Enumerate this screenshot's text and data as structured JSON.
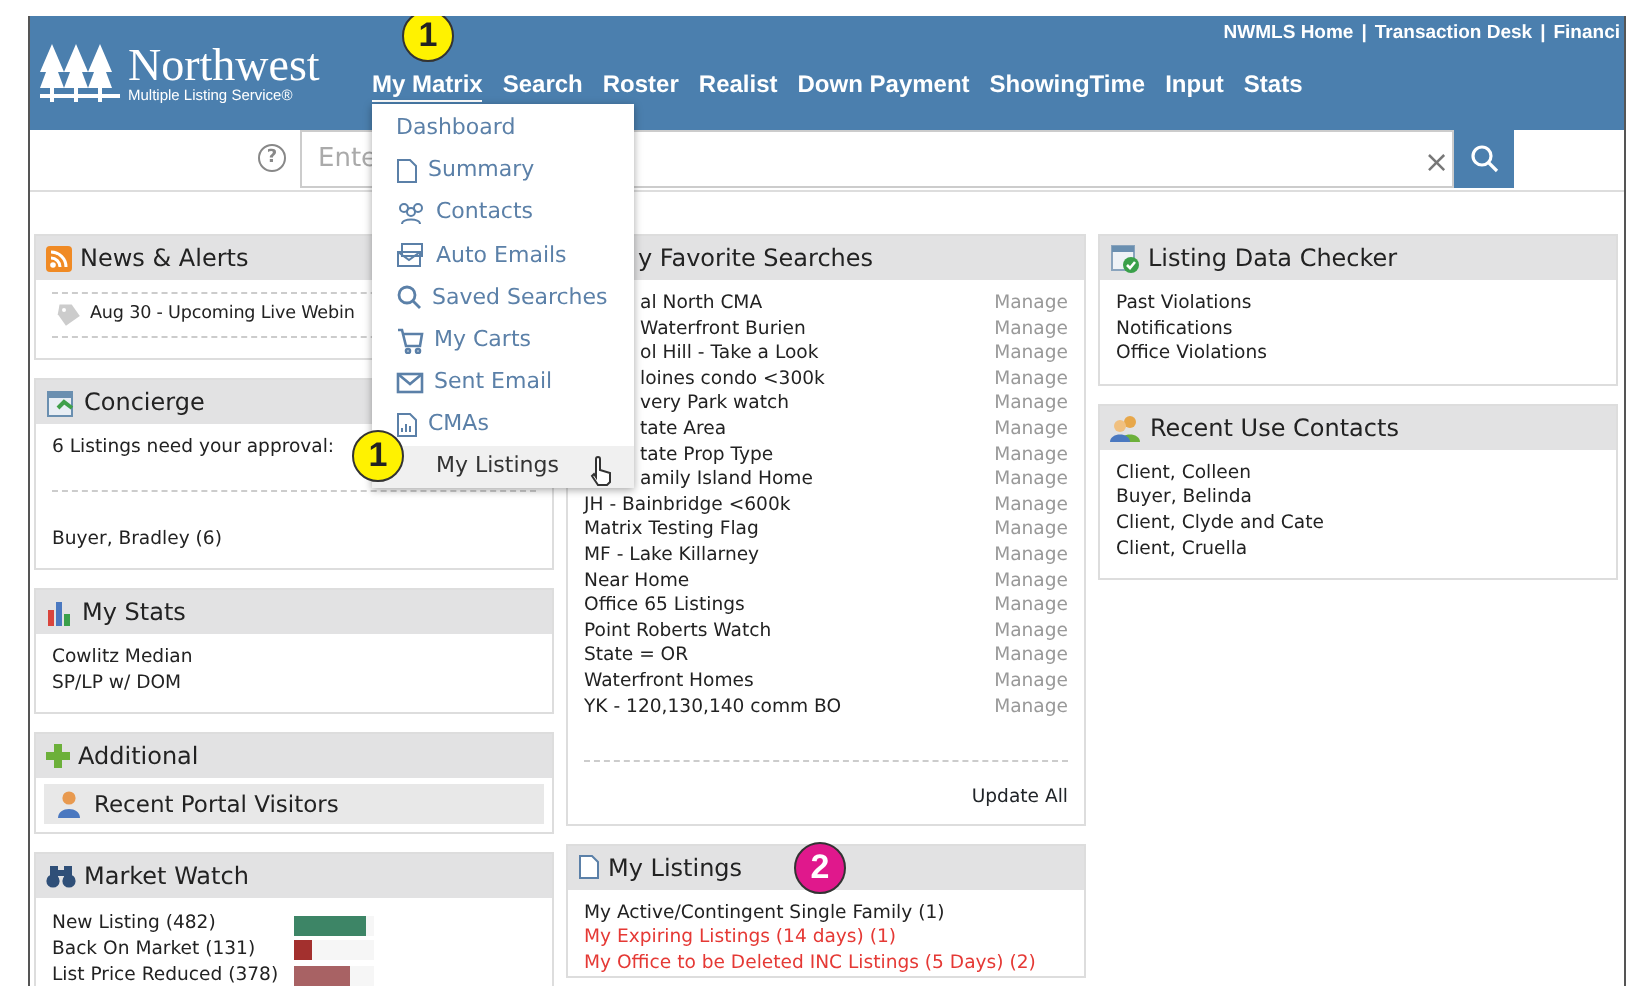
{
  "header": {
    "logo_title": "Northwest",
    "logo_subtitle": "Multiple Listing Service®",
    "top_links": [
      "NWMLS Home",
      "Transaction Desk",
      "Financi"
    ],
    "top_separator": "|",
    "nav": [
      {
        "label": "My Matrix",
        "selected": true,
        "callout": {
          "text": "1",
          "color": "#fff200"
        }
      },
      {
        "label": "Search",
        "selected": false
      },
      {
        "label": "Roster",
        "selected": false
      },
      {
        "label": "Realist",
        "selected": false
      },
      {
        "label": "Down Payment",
        "selected": false
      },
      {
        "label": "ShowingTime",
        "selected": false
      },
      {
        "label": "Input",
        "selected": false
      },
      {
        "label": "Stats",
        "selected": false
      }
    ]
  },
  "search": {
    "help": "?",
    "placeholder": "Ente",
    "clear": "×"
  },
  "nav_menu": {
    "items": [
      {
        "label": "Dashboard",
        "hovered": false
      },
      {
        "label": "Summary",
        "hovered": false
      },
      {
        "label": "Contacts",
        "hovered": false
      },
      {
        "label": "Auto Emails",
        "hovered": false
      },
      {
        "label": "Saved Searches",
        "hovered": false
      },
      {
        "label": "My Carts",
        "hovered": false
      },
      {
        "label": "Sent Email",
        "hovered": false
      },
      {
        "label": "CMAs",
        "hovered": false
      },
      {
        "label": "My Listings",
        "hovered": true,
        "callout": {
          "text": "1",
          "color": "#fff200"
        }
      }
    ]
  },
  "columns": [
    [
      {
        "title": "News & Alerts",
        "kind": "news",
        "items": [
          "Aug 30 - Upcoming Live Webin"
        ]
      },
      {
        "title": "Concierge",
        "kind": "approval",
        "prompt": "6 Listings need your approval:",
        "items": [
          "Buyer, Bradley (6)"
        ]
      },
      {
        "title": "My Stats",
        "kind": "links",
        "items": [
          {
            "text": "Cowlitz Median",
            "alert": false
          },
          {
            "text": "SP/LP w/ DOM",
            "alert": false
          }
        ]
      },
      {
        "title": "Additional",
        "kind": "sublinks",
        "items": [
          "Recent Portal Visitors"
        ]
      },
      {
        "title": "Market Watch",
        "kind": "bars",
        "items": [
          {
            "label": "New Listing (482)",
            "level": 0.9,
            "color": "#3d8566"
          },
          {
            "label": "Back On Market (131)",
            "level": 0.22,
            "color": "#a3302e"
          },
          {
            "label": "List Price Reduced (378)",
            "level": 0.7,
            "color": "#a86264"
          }
        ]
      }
    ],
    [
      {
        "title": "y Favorite Searches",
        "title_clipped": true,
        "kind": "manage",
        "footer": "Update All",
        "rows": [
          {
            "name": "al North CMA",
            "action": "Manage",
            "clipped": true
          },
          {
            "name": "Waterfront Burien",
            "action": "Manage",
            "clipped": true
          },
          {
            "name": "ol Hill - Take a Look",
            "action": "Manage",
            "clipped": true
          },
          {
            "name": "loines condo <300k",
            "action": "Manage",
            "clipped": true
          },
          {
            "name": "very Park watch",
            "action": "Manage",
            "clipped": true
          },
          {
            "name": "tate Area",
            "action": "Manage",
            "clipped": true
          },
          {
            "name": "tate Prop Type",
            "action": "Manage",
            "clipped": true
          },
          {
            "name": "amily Island Home",
            "action": "Manage",
            "clipped": true
          },
          {
            "name": "JH - Bainbridge <600k",
            "action": "Manage",
            "clipped": false
          },
          {
            "name": "Matrix Testing Flag",
            "action": "Manage",
            "clipped": false
          },
          {
            "name": "MF - Lake Killarney",
            "action": "Manage",
            "clipped": false
          },
          {
            "name": "Near Home",
            "action": "Manage",
            "clipped": false
          },
          {
            "name": "Office 65 Listings",
            "action": "Manage",
            "clipped": false
          },
          {
            "name": "Point Roberts Watch",
            "action": "Manage",
            "clipped": false
          },
          {
            "name": "State = OR",
            "action": "Manage",
            "clipped": false
          },
          {
            "name": "Waterfront Homes",
            "action": "Manage",
            "clipped": false
          },
          {
            "name": "YK - 120,130,140 comm BO",
            "action": "Manage",
            "clipped": false
          }
        ]
      },
      {
        "title": "My Listings",
        "kind": "links",
        "callout": {
          "text": "2",
          "color": "#e0188c"
        },
        "items": [
          {
            "text": "My Active/Contingent Single Family (1)",
            "alert": false
          },
          {
            "text": "My Expiring Listings (14 days) (1)",
            "alert": true
          },
          {
            "text": "My Office to be Deleted INC Listings (5 Days) (2)",
            "alert": true
          }
        ]
      }
    ],
    [
      {
        "title": "Listing Data Checker",
        "kind": "links",
        "items": [
          {
            "text": "Past Violations",
            "alert": false
          },
          {
            "text": "Notifications",
            "alert": false
          },
          {
            "text": "Office Violations",
            "alert": false
          }
        ]
      },
      {
        "title": "Recent Use Contacts",
        "kind": "links",
        "items": [
          {
            "text": "Client, Colleen",
            "alert": false
          },
          {
            "text": "Buyer, Belinda",
            "alert": false
          },
          {
            "text": "Client, Clyde and Cate",
            "alert": false
          },
          {
            "text": "Client, Cruella",
            "alert": false
          }
        ]
      }
    ]
  ]
}
